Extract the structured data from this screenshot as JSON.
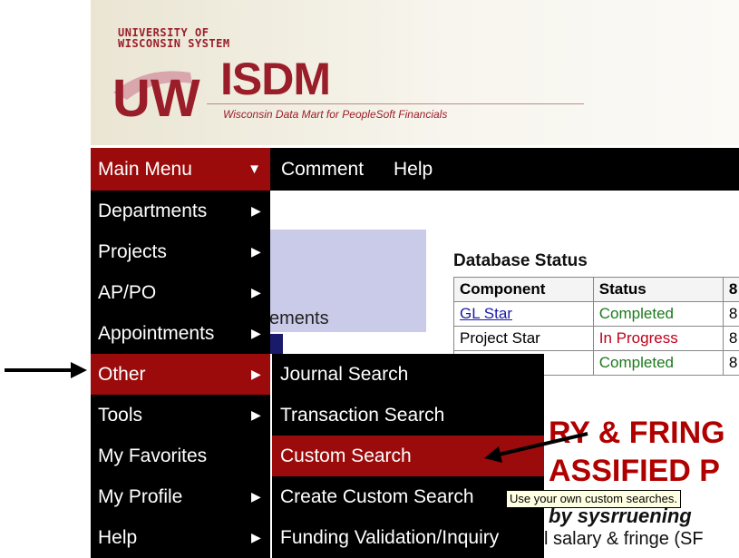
{
  "header": {
    "logo_line1": "UNIVERSITY OF",
    "logo_line2": "WISCONSIN SYSTEM",
    "logo_mark": "UW",
    "logo_name": "ISDM",
    "tagline": "Wisconsin Data Mart for PeopleSoft Financials"
  },
  "menubar": {
    "main_menu": "Main Menu",
    "comment": "Comment",
    "help": "Help"
  },
  "left_menu": [
    {
      "label": "Departments",
      "submenu": true
    },
    {
      "label": "Projects",
      "submenu": true
    },
    {
      "label": "AP/PO",
      "submenu": true
    },
    {
      "label": "Appointments",
      "submenu": true
    },
    {
      "label": "Other",
      "submenu": true,
      "selected": true
    },
    {
      "label": "Tools",
      "submenu": true
    },
    {
      "label": "My Favorites",
      "submenu": false
    },
    {
      "label": "My Profile",
      "submenu": true
    },
    {
      "label": "Help",
      "submenu": true
    }
  ],
  "submenu": [
    {
      "label": "Journal Search"
    },
    {
      "label": "Transaction Search"
    },
    {
      "label": "Custom Search",
      "selected": true
    },
    {
      "label": "Create Custom Search"
    },
    {
      "label": "Funding Validation/Inquiry"
    }
  ],
  "tooltip": "Use your own custom searches.",
  "content": {
    "panel_text": "ements",
    "db_title": "Database Status",
    "db_columns": [
      "Component",
      "Status",
      "8"
    ],
    "db_rows": [
      {
        "component": "GL Star",
        "status": "Completed",
        "extra": "8"
      },
      {
        "component": "Project Star",
        "status": "In Progress",
        "extra": "8"
      },
      {
        "component": "",
        "status": "Completed",
        "extra": "8"
      }
    ],
    "headline1": "RY & FRING",
    "headline2": "ASSIFIED P",
    "byline": "by sysrruening",
    "body": "l salary & fringe (SF"
  },
  "colors": {
    "menu_bg": "#000000",
    "menu_selected": "#9b0b0b",
    "brand": "#9a1e2a",
    "panel": "#c9cbe9"
  }
}
